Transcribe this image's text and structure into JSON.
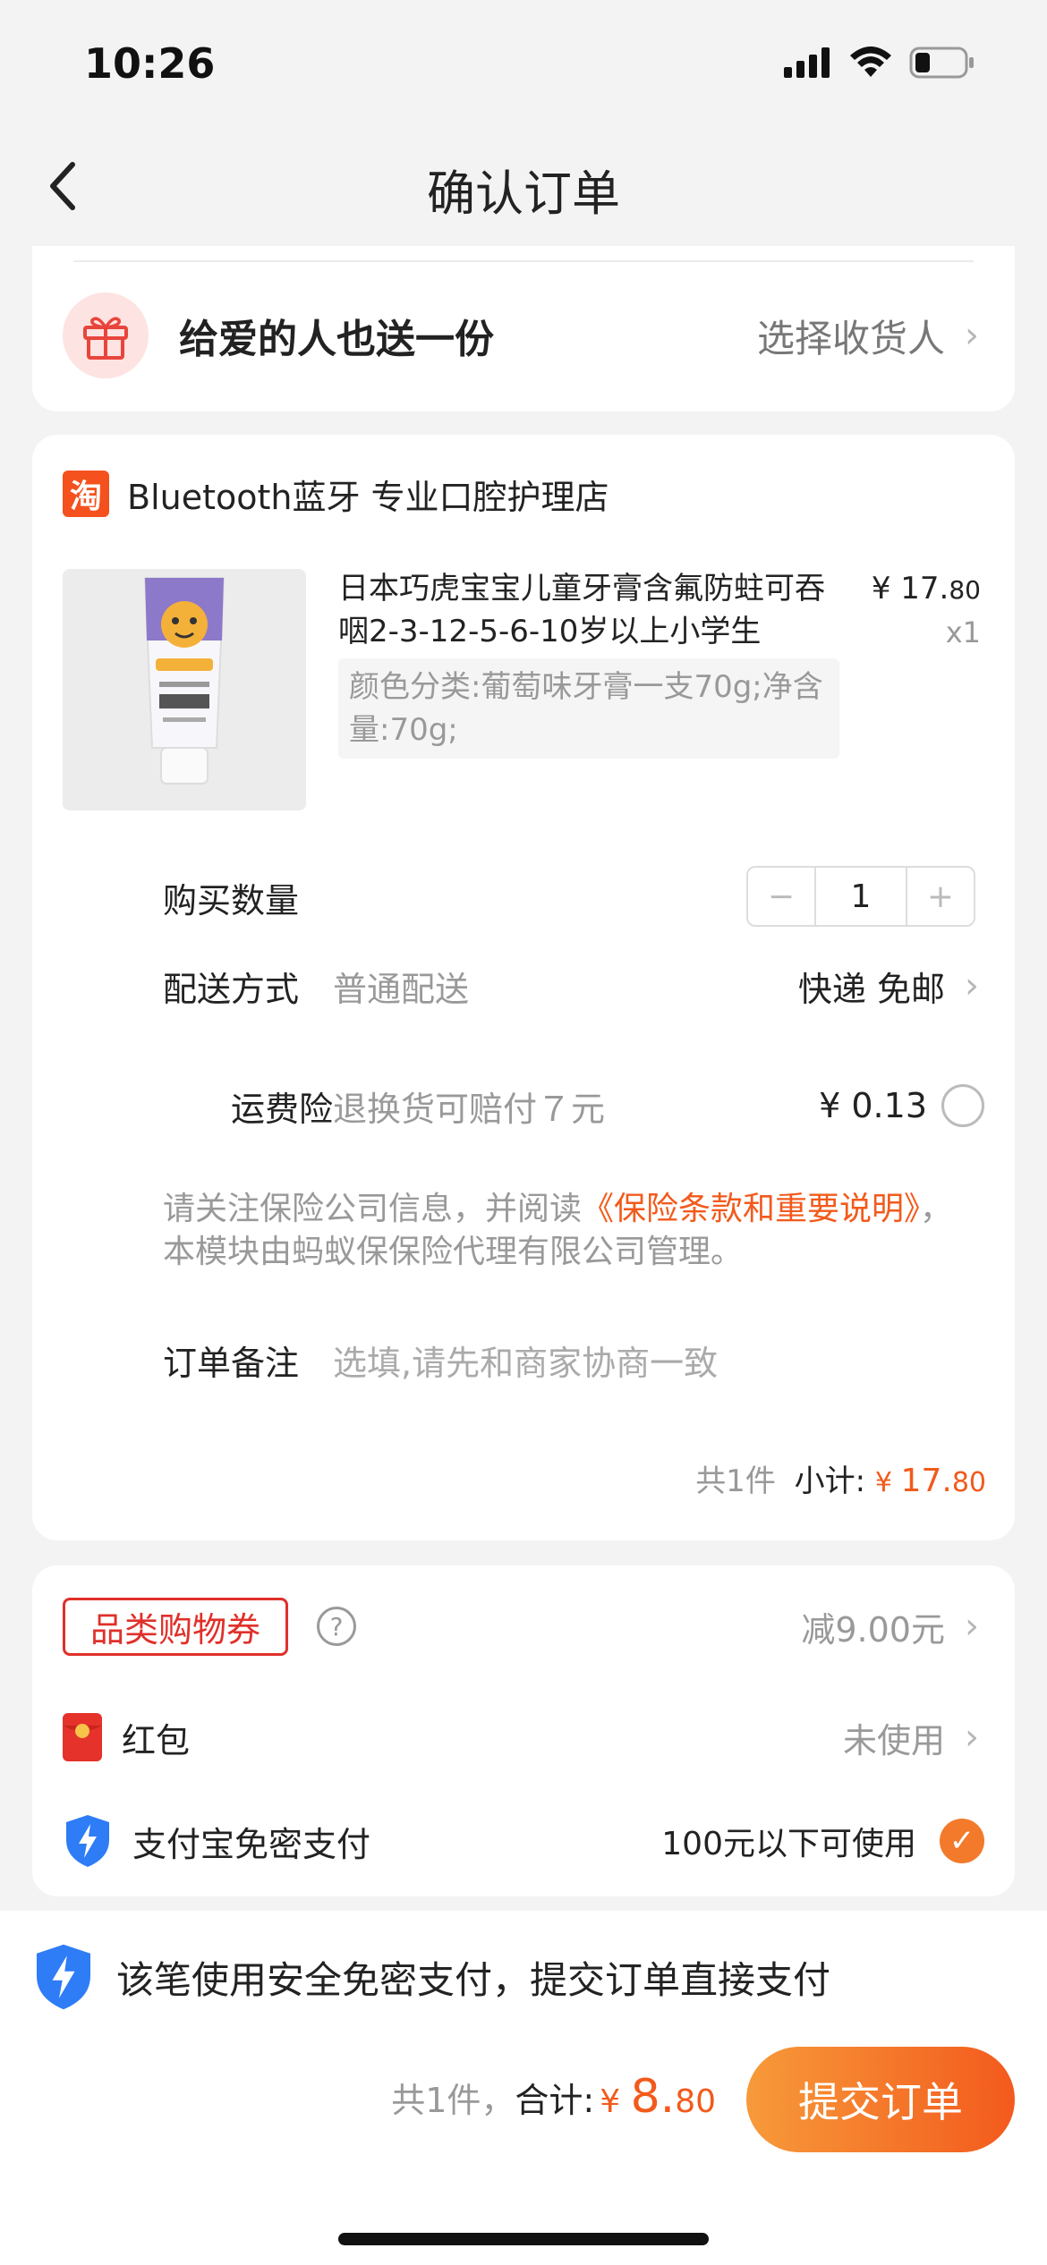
{
  "status": {
    "time": "10:26"
  },
  "nav": {
    "title": "确认订单"
  },
  "gift": {
    "label": "给爱的人也送一份",
    "action": "选择收货人"
  },
  "shop": {
    "logo_char": "淘",
    "name": "Bluetooth蓝牙 专业口腔护理店"
  },
  "product": {
    "title": "日本巧虎宝宝儿童牙膏含氟防蛀可吞咽2-3-12-5-6-10岁以上小学生",
    "price_main": "¥ 17.",
    "price_cents": "80",
    "qty": "x1",
    "sku": "颜色分类:葡萄味牙膏一支70g;净含量:70g;"
  },
  "quantity": {
    "label": "购买数量",
    "minus": "−",
    "value": "1",
    "plus": "+"
  },
  "delivery": {
    "label": "配送方式",
    "value": "普通配送",
    "option": "快递 免邮"
  },
  "insurance": {
    "label": "运费险",
    "desc": "退换货可赔付７元",
    "price": "¥ 0.13",
    "notice_pre": "请关注保险公司信息，并阅读",
    "notice_link": "《保险条款和重要说明》",
    "notice_post": "，本模块由蚂蚁保保险代理有限公司管理。"
  },
  "remark": {
    "label": "订单备注",
    "placeholder": "选填,请先和商家协商一致"
  },
  "subtotal": {
    "count": "共1件",
    "label": "小计:",
    "currency": "¥ ",
    "main": "17.",
    "cents": "80"
  },
  "coupon": {
    "tag": "品类购物券",
    "help": "?",
    "value": "减9.00元"
  },
  "redpacket": {
    "label": "红包",
    "value": "未使用"
  },
  "alipay": {
    "label": "支付宝免密支付",
    "value": "100元以下可使用"
  },
  "bottom": {
    "secure_text": "该笔使用安全免密支付，提交订单直接支付",
    "count": "共1件，",
    "total_label": "合计:",
    "currency": "¥ ",
    "total_main": "8.",
    "total_cents": "80",
    "submit": "提交订单"
  },
  "colors": {
    "accent": "#f25a1c",
    "button_from": "#f79a3a",
    "button_to": "#f35a1d"
  }
}
